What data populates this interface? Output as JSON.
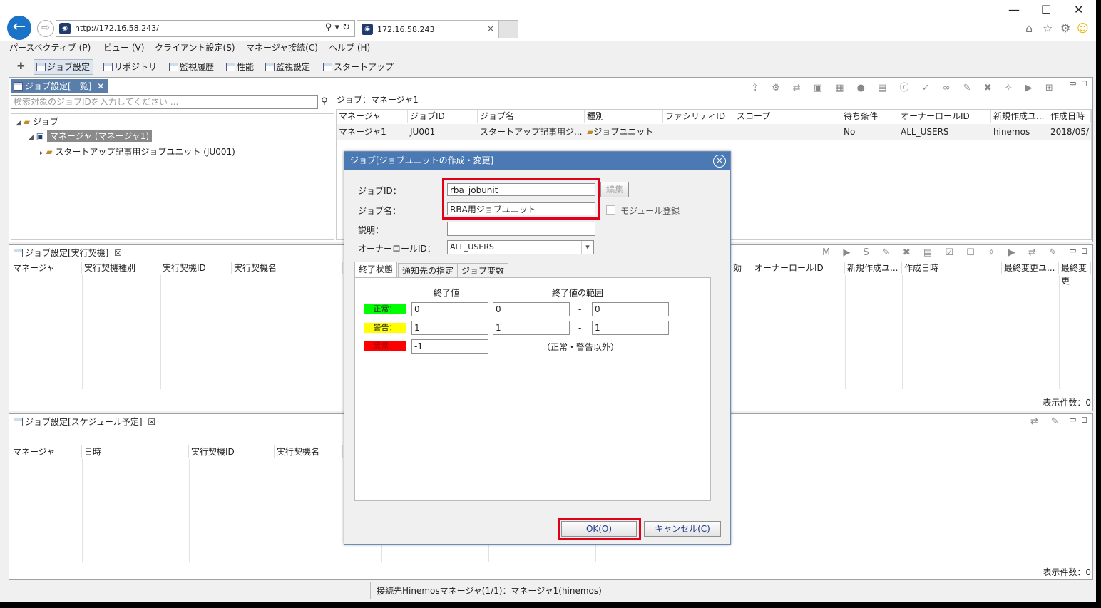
{
  "browser": {
    "url": "http://172.16.58.243/",
    "tab_title": "172.16.58.243",
    "favicon": "hinemos-favicon",
    "tab_close": "×",
    "minimize": "—",
    "maximize": "☐",
    "close": "✕",
    "back": "←",
    "forward": "⇨",
    "addr_controls": "⚲ ▾ ↻",
    "home": "⌂",
    "favorites": "☆",
    "settings": "⚙",
    "smiley": "☺"
  },
  "menu": [
    "パースペクティブ (P)",
    "ビュー (V)",
    "クライアント設定(S)",
    "マネージャ接続(C)",
    "ヘルプ (H)"
  ],
  "toolbar": [
    "ジョブ設定",
    "リポジトリ",
    "監視履歴",
    "性能",
    "監視設定",
    "スタートアップ"
  ],
  "job_list_panel": {
    "tab": "ジョブ設定[一覧]",
    "tab_close": "✕",
    "search_placeholder": "検索対象のジョブIDを入力してください ...",
    "search_icon": "search-icon",
    "tree": [
      {
        "label": "ジョブ",
        "level": 0
      },
      {
        "label": "マネージャ (マネージャ1)",
        "level": 1
      },
      {
        "label": "スタートアップ記事用ジョブユニット (JU001)",
        "level": 2
      }
    ],
    "detail_header": "ジョブ：マネージャ1",
    "columns": [
      "マネージャ",
      "ジョブID",
      "ジョブ名",
      "種別",
      "ファシリティID",
      "スコープ",
      "待ち条件",
      "オーナーロールID",
      "新規作成ユ...",
      "作成日時"
    ],
    "row": [
      "マネージャ1",
      "JU001",
      "スタートアップ記事用ジ...",
      "ジョブユニット",
      "",
      "",
      "No",
      "ALL_USERS",
      "hinemos",
      "2018/05/"
    ]
  },
  "exec_panel": {
    "tab": "ジョブ設定[実行契機]",
    "tab_close": "☒",
    "columns_left": [
      "マネージャ",
      "実行契機種別",
      "実行契機ID",
      "実行契機名"
    ],
    "columns_right": [
      "効",
      "オーナーロールID",
      "新規作成ユ...",
      "作成日時",
      "最終変更ユ...",
      "最終変更"
    ],
    "count": "表示件数：0"
  },
  "schedule_panel": {
    "tab": "ジョブ設定[スケジュール予定]",
    "tab_close": "☒",
    "columns": [
      "マネージャ",
      "日時",
      "実行契機ID",
      "実行契機名"
    ],
    "count": "表示件数：0"
  },
  "dialog": {
    "title": "ジョブ[ジョブユニットの作成・変更]",
    "close": "✕",
    "job_id_label": "ジョブID：",
    "job_id_value": "rba_jobunit",
    "edit_button": "編集",
    "job_name_label": "ジョブ名：",
    "job_name_value": "RBA用ジョブユニット",
    "module_label": "モジュール登録",
    "desc_label": "説明：",
    "desc_value": "",
    "owner_label": "オーナーロールID：",
    "owner_value": "ALL_USERS",
    "dropdown_arrow": "▾",
    "tabs": [
      "終了状態",
      "通知先の指定",
      "ジョブ変数"
    ],
    "end_value_header": "終了値",
    "range_header": "終了値の範囲",
    "normal_label": "正常：",
    "normal_value": "0",
    "normal_from": "0",
    "normal_to": "0",
    "warn_label": "警告：",
    "warn_value": "1",
    "warn_from": "1",
    "warn_to": "1",
    "error_label": "異常：",
    "error_value": "-1",
    "error_note": "（正常・警告以外）",
    "range_sep": "-",
    "ok": "OK(O)",
    "cancel": "キャンセル(C)"
  },
  "colors": {
    "normal": "#00ff00",
    "warning": "#ffff00",
    "error": "#ff0000",
    "highlight_box": "#e0001a",
    "title_bar": "#4b79b3"
  },
  "status_bar": "接続先Hinemosマネージャ(1/1)：マネージャ1(hinemos)"
}
